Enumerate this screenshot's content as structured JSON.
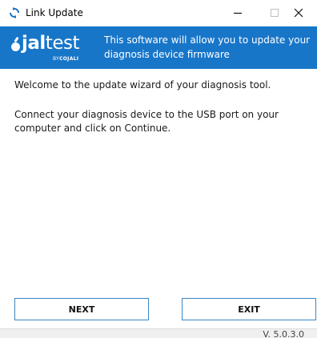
{
  "window": {
    "title": "Link Update",
    "minimize_glyph": "—",
    "maximize_glyph": "☐",
    "close_glyph": "✕"
  },
  "banner": {
    "logo": {
      "brand_bold": "jal",
      "brand_regular": "test",
      "byline_prefix": "BY",
      "byline_brand": "COJALI"
    },
    "message": "This software will allow you to update your diagnosis device firmware",
    "background_color": "#1876c9"
  },
  "content": {
    "welcome": "Welcome to the update wizard of your diagnosis tool.",
    "instruction": "Connect your diagnosis device to the USB port on your computer and click on Continue."
  },
  "buttons": {
    "next_label": "NEXT",
    "exit_label": "EXIT",
    "border_color": "#3a86c8"
  },
  "footer": {
    "version": "V. 5.0.3.0"
  },
  "icons": {
    "app": "refresh-arrows-icon"
  }
}
